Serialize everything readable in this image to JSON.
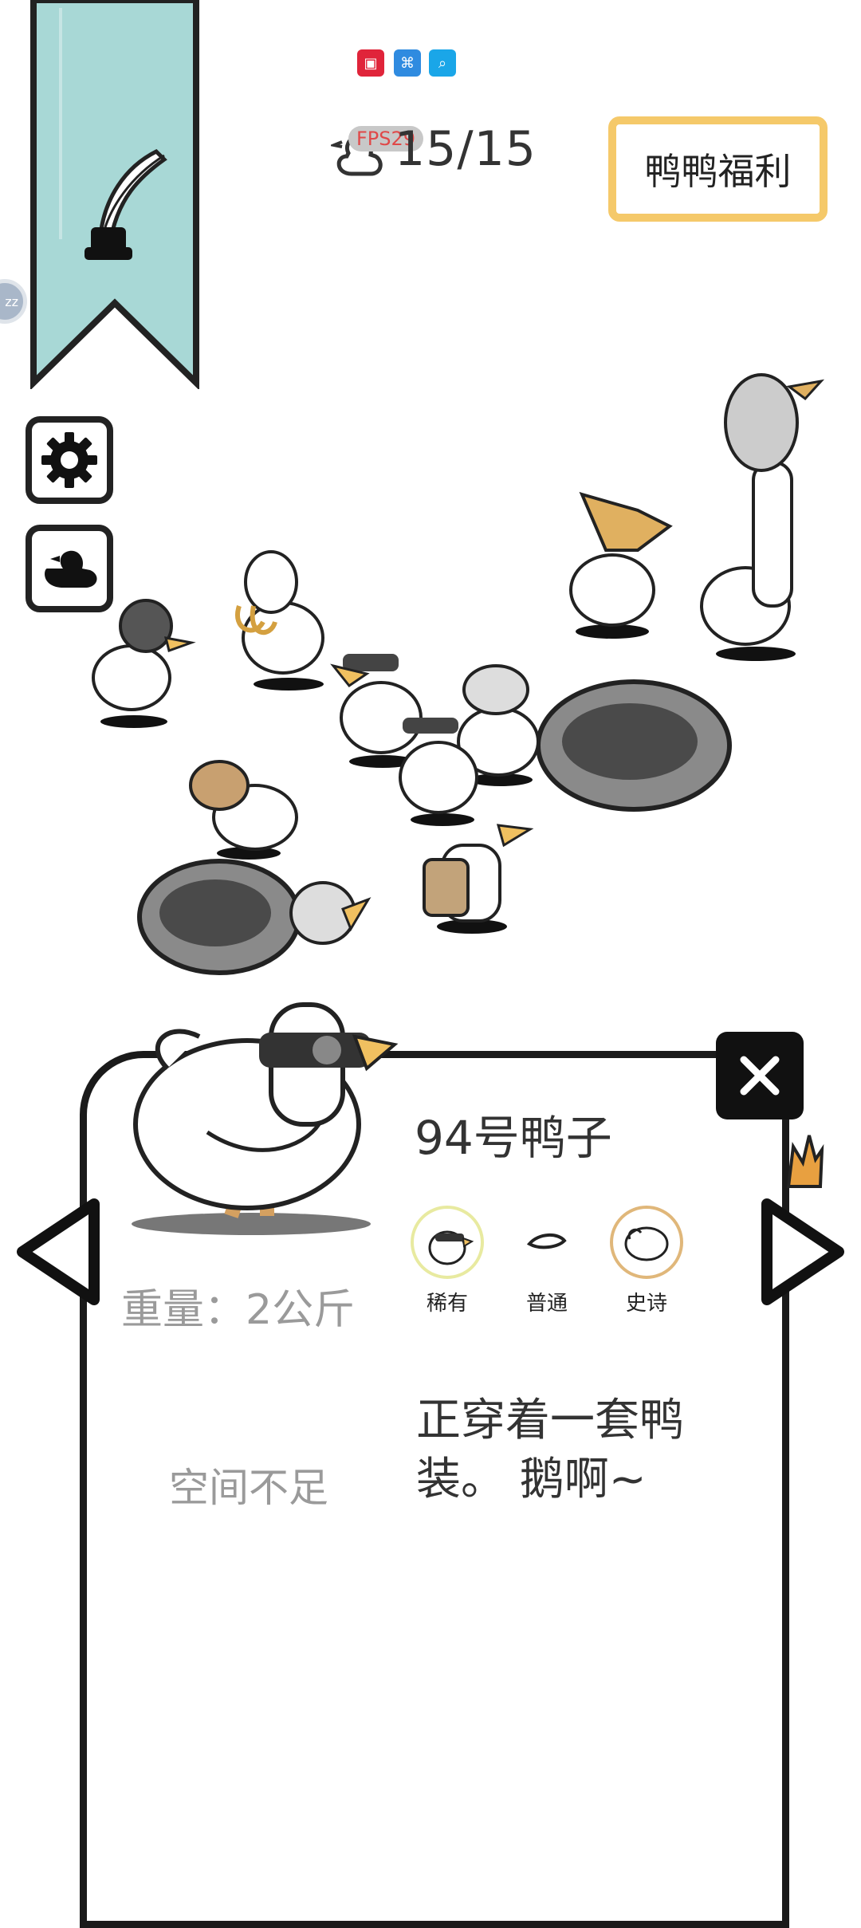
{
  "top_icons": [
    "tmall-app-icon",
    "code-app-icon",
    "search-app-icon"
  ],
  "counter": {
    "fps": "FPS29",
    "value": "15/15"
  },
  "welfare_button": "鸭鸭福利",
  "edge_chip": "zz",
  "detail": {
    "name": "94号鸭子",
    "weight": "重量：2公斤",
    "space": "空间不足",
    "description": "正穿着一套鸭装。 鹅啊~",
    "parts": [
      {
        "label": "稀有",
        "ring": "#e8eaa0"
      },
      {
        "label": "普通",
        "ring": "none"
      },
      {
        "label": "史诗",
        "ring": "#e0b77a"
      }
    ]
  },
  "colors": {
    "ribbon": "#a8d8d6",
    "welfare_border": "#f5c96a",
    "fps_text": "#e04848"
  }
}
